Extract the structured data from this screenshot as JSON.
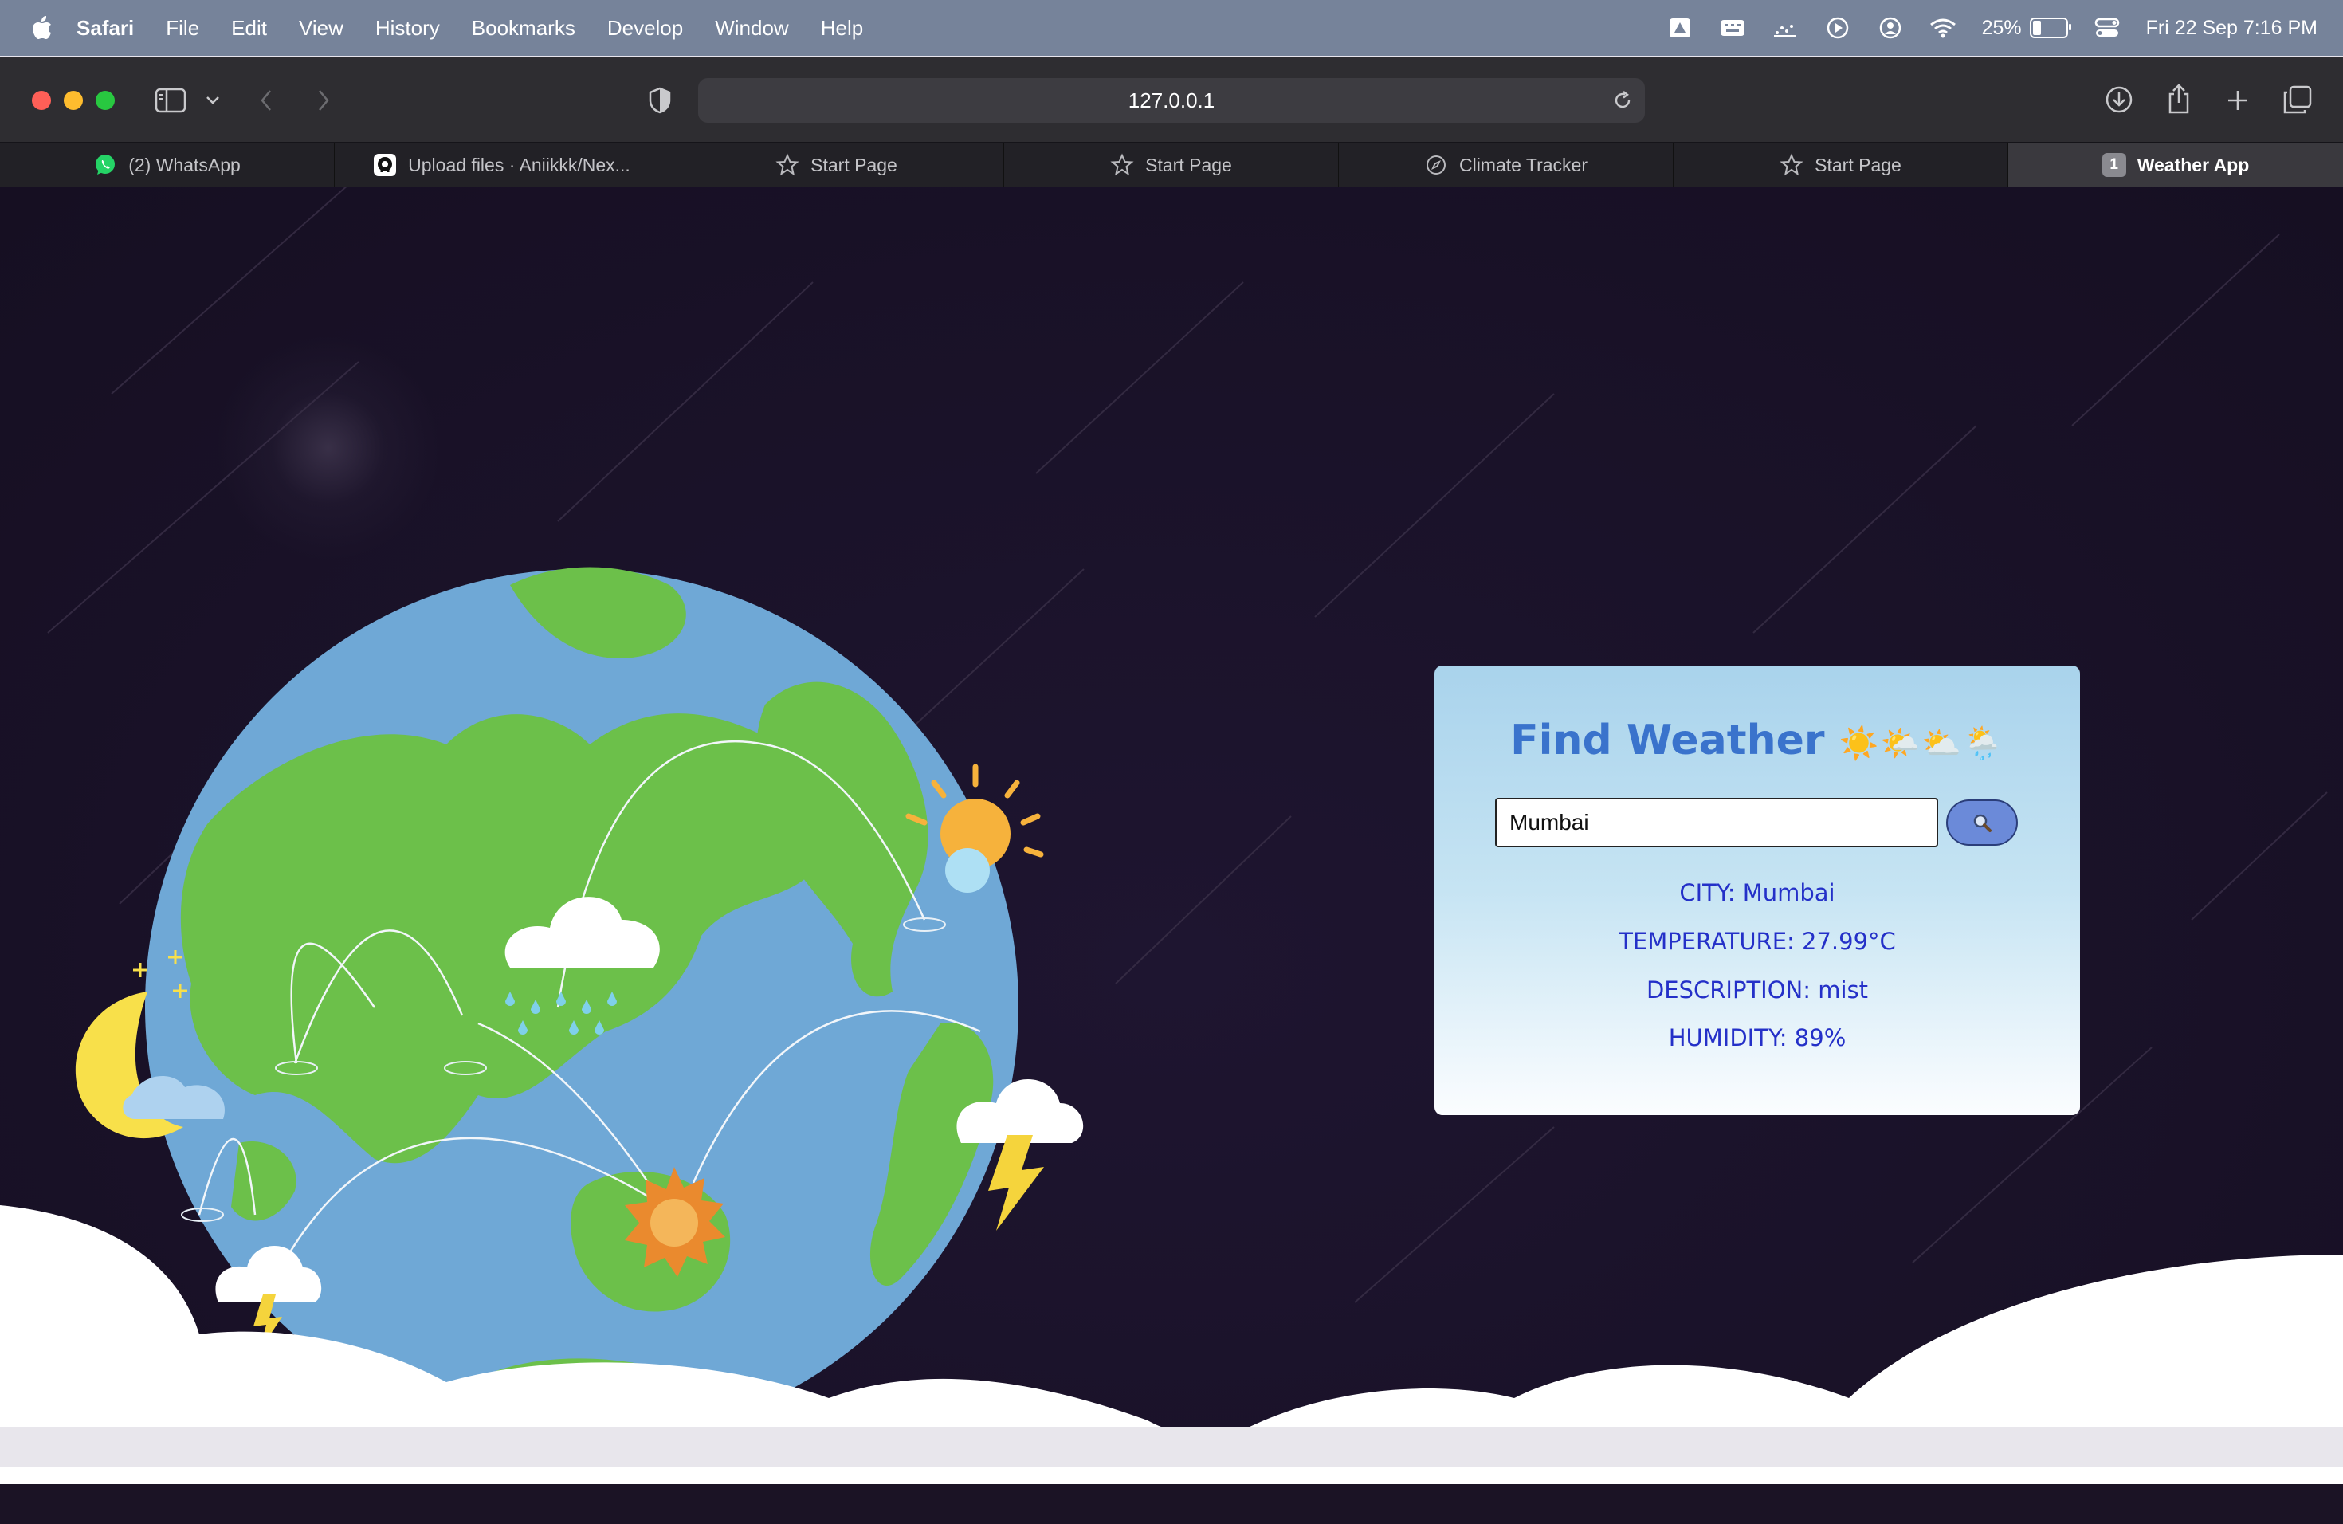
{
  "menubar": {
    "app_name": "Safari",
    "items": [
      "File",
      "Edit",
      "View",
      "History",
      "Bookmarks",
      "Develop",
      "Window",
      "Help"
    ],
    "battery": "25%",
    "datetime": "Fri 22 Sep  7:16 PM",
    "status_icons": [
      "drive-icon",
      "keyboard-icon",
      "activity-icon",
      "play-icon",
      "user-icon",
      "wifi-icon",
      "control-center-icon"
    ]
  },
  "browser": {
    "url": "127.0.0.1",
    "tabs": [
      {
        "label": "(2) WhatsApp",
        "icon": "whatsapp-icon"
      },
      {
        "label": "Upload files · Aniikkk/Nex...",
        "icon": "github-icon"
      },
      {
        "label": "Start Page",
        "icon": "star-icon"
      },
      {
        "label": "Start Page",
        "icon": "star-icon"
      },
      {
        "label": "Climate Tracker",
        "icon": "compass-icon"
      },
      {
        "label": "Start Page",
        "icon": "star-icon"
      },
      {
        "label": "Weather App",
        "icon": "tab-number-badge",
        "badge": "1",
        "active": true
      }
    ]
  },
  "weather": {
    "title": "Find Weather",
    "title_emoji": "☀️🌤️⛅🌦️",
    "search_value": "Mumbai",
    "search_button_icon": "magnifier-icon",
    "city": "CITY: Mumbai",
    "temperature": "TEMPERATURE: 27.99°C",
    "description": "DESCRIPTION: mist",
    "humidity": "HUMIDITY: 89%"
  },
  "colors": {
    "page_background": "#1b1325",
    "card_gradient_top": "#a9d3ec",
    "card_title": "#3a73cc",
    "card_text": "#2430c8",
    "ocean": "#6fa8d6",
    "land": "#6cc04a"
  }
}
